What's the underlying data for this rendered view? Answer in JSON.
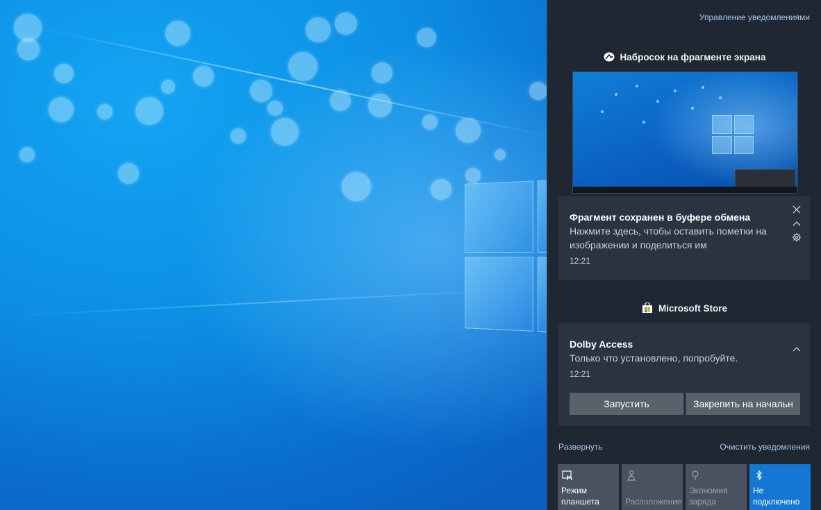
{
  "action_center": {
    "manage_notifications": "Управление уведомлениями",
    "groups": [
      {
        "app_name": "Набросок на фрагменте экрана",
        "icon": "snip-sketch-icon",
        "notification": {
          "title": "Фрагмент сохранен в буфере обмена",
          "body": "Нажмите здесь, чтобы оставить пометки на изображении и поделиться им",
          "time": "12:21"
        }
      },
      {
        "app_name": "Microsoft Store",
        "icon": "store-bag-icon",
        "notification": {
          "title": "Dolby Access",
          "body": "Только что установлено, попробуйте.",
          "time": "12:21",
          "buttons": [
            "Запустить",
            "Закрепить на начальн"
          ]
        }
      }
    ],
    "expand_label": "Развернуть",
    "clear_label": "Очистить уведомления",
    "quick_actions": [
      {
        "label_line1": "Режим",
        "label_line2": "планшета",
        "icon": "tablet-mode-icon",
        "state": "off"
      },
      {
        "label_line1": "",
        "label_line2": "Расположение",
        "icon": "location-icon",
        "state": "disabled"
      },
      {
        "label_line1": "Экономия",
        "label_line2": "заряда",
        "icon": "battery-saver-icon",
        "state": "disabled"
      },
      {
        "label_line1": "Не",
        "label_line2": "подключено",
        "icon": "bluetooth-icon",
        "state": "on"
      }
    ]
  },
  "colors": {
    "panel_bg": "#1f2733",
    "toast_bg": "#2b3340",
    "accent": "#1477d4",
    "link": "#a9c7ea"
  }
}
